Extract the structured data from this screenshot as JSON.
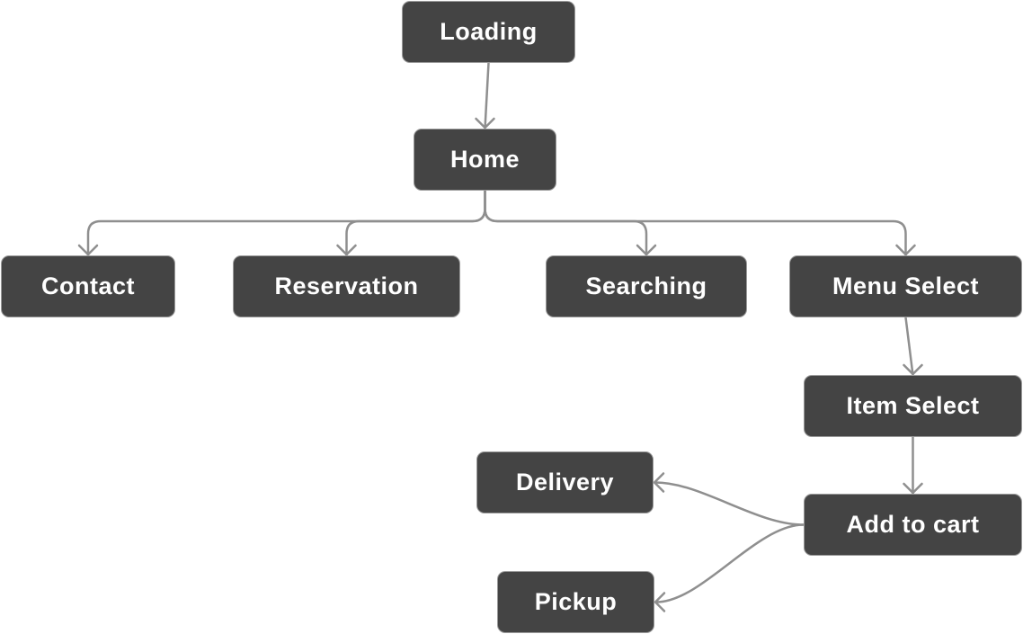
{
  "colors": {
    "node_fill": "#444444",
    "node_border": "#9a9a9a",
    "node_text": "#ffffff",
    "edge": "#8f8f8f"
  },
  "nodes": [
    {
      "id": "loading",
      "label": "Loading"
    },
    {
      "id": "home",
      "label": "Home"
    },
    {
      "id": "contact",
      "label": "Contact"
    },
    {
      "id": "reservation",
      "label": "Reservation"
    },
    {
      "id": "searching",
      "label": "Searching"
    },
    {
      "id": "menu-select",
      "label": "Menu Select"
    },
    {
      "id": "item-select",
      "label": "Item Select"
    },
    {
      "id": "add-to-cart",
      "label": "Add to cart"
    },
    {
      "id": "delivery",
      "label": "Delivery"
    },
    {
      "id": "pickup",
      "label": "Pickup"
    }
  ],
  "edges": [
    {
      "from": "loading",
      "to": "home"
    },
    {
      "from": "home",
      "to": "contact"
    },
    {
      "from": "home",
      "to": "reservation"
    },
    {
      "from": "home",
      "to": "searching"
    },
    {
      "from": "home",
      "to": "menu-select"
    },
    {
      "from": "menu-select",
      "to": "item-select"
    },
    {
      "from": "item-select",
      "to": "add-to-cart"
    },
    {
      "from": "add-to-cart",
      "to": "delivery"
    },
    {
      "from": "add-to-cart",
      "to": "pickup"
    }
  ]
}
